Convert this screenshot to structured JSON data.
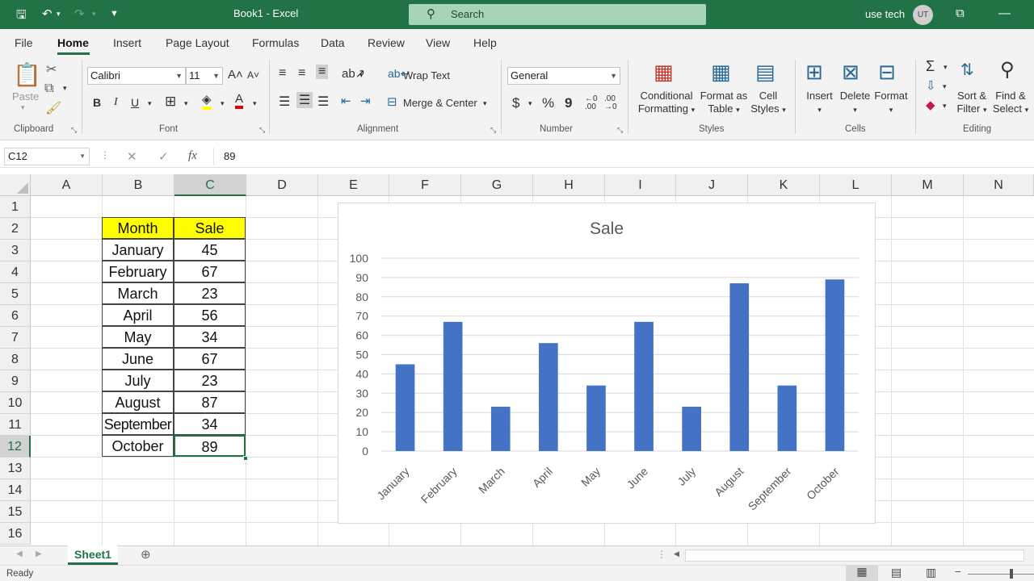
{
  "window": {
    "title": "Book1  -  Excel",
    "search_placeholder": "Search",
    "user_name": "use tech",
    "user_initials": "UT"
  },
  "tabs": [
    "File",
    "Home",
    "Insert",
    "Page Layout",
    "Formulas",
    "Data",
    "Review",
    "View",
    "Help"
  ],
  "ribbon": {
    "clipboard": {
      "label": "Clipboard",
      "paste": "Paste"
    },
    "font": {
      "label": "Font",
      "family": "Calibri",
      "size": "11",
      "bold": "B",
      "italic": "I",
      "underline": "U"
    },
    "alignment": {
      "label": "Alignment",
      "wrap_text": "Wrap Text",
      "merge_center": "Merge & Center"
    },
    "number": {
      "label": "Number",
      "format": "General",
      "currency": "$",
      "percent": "%",
      "comma": "9"
    },
    "styles": {
      "label": "Styles",
      "conditional_l1": "Conditional",
      "conditional_l2": "Formatting",
      "format_table_l1": "Format as",
      "format_table_l2": "Table",
      "cell_styles_l1": "Cell",
      "cell_styles_l2": "Styles"
    },
    "cells": {
      "label": "Cells",
      "insert": "Insert",
      "delete": "Delete",
      "format": "Format"
    },
    "editing": {
      "label": "Editing",
      "sort_l1": "Sort &",
      "sort_l2": "Filter",
      "find_l1": "Find &",
      "find_l2": "Select"
    }
  },
  "formula_bar": {
    "name_box": "C12",
    "cancel": "✕",
    "enter": "✓",
    "fx": "fx",
    "value": "89"
  },
  "columns": [
    "A",
    "B",
    "C",
    "D",
    "E",
    "F",
    "G",
    "H",
    "I",
    "J",
    "K",
    "L",
    "M",
    "N"
  ],
  "rows": [
    "1",
    "2",
    "3",
    "4",
    "5",
    "6",
    "7",
    "8",
    "9",
    "10",
    "11",
    "12",
    "13",
    "14",
    "15",
    "16"
  ],
  "table": {
    "header_month": "Month",
    "header_sale": "Sale",
    "months": [
      "January",
      "February",
      "March",
      "April",
      "May",
      "June",
      "July",
      "August",
      "September",
      "October"
    ],
    "sales": [
      "45",
      "67",
      "23",
      "56",
      "34",
      "67",
      "23",
      "87",
      "34",
      "89"
    ]
  },
  "chart_data": {
    "type": "bar",
    "title": "Sale",
    "categories": [
      "January",
      "February",
      "March",
      "April",
      "May",
      "June",
      "July",
      "August",
      "September",
      "October"
    ],
    "values": [
      45,
      67,
      23,
      56,
      34,
      67,
      23,
      87,
      34,
      89
    ],
    "ylim": [
      0,
      100
    ],
    "yticks": [
      0,
      10,
      20,
      30,
      40,
      50,
      60,
      70,
      80,
      90,
      100
    ],
    "grid": true,
    "bar_color": "#4472c4"
  },
  "sheet": {
    "tab_name": "Sheet1",
    "status": "Ready"
  },
  "colors": {
    "accent": "#217346",
    "header_fill": "#ffff00"
  }
}
